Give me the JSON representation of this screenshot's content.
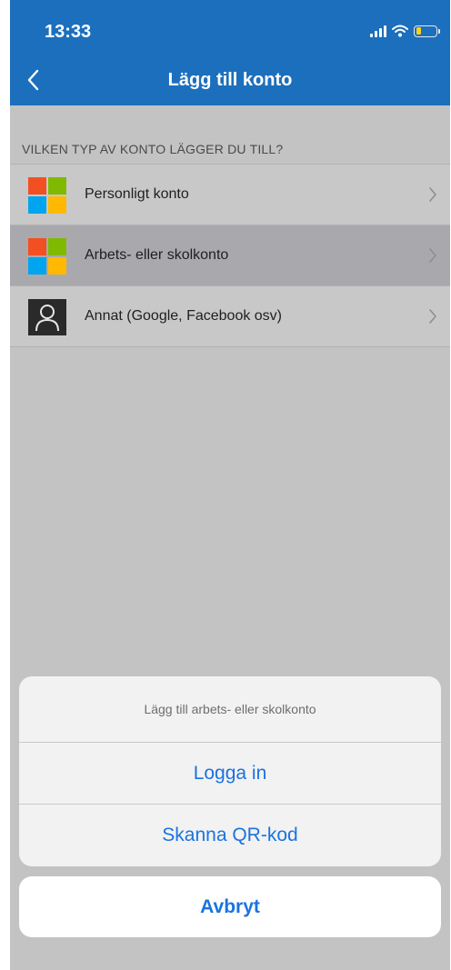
{
  "status_bar": {
    "time": "13:33",
    "icons": [
      "signal-icon",
      "wifi-icon",
      "battery-icon"
    ]
  },
  "nav": {
    "title": "Lägg till konto",
    "back_icon": "chevron-left-icon"
  },
  "section": {
    "header": "VILKEN TYP AV KONTO LÄGGER DU TILL?"
  },
  "accounts": [
    {
      "label": "Personligt konto",
      "icon": "microsoft-logo-icon",
      "selected": false
    },
    {
      "label": "Arbets- eller skolkonto",
      "icon": "microsoft-logo-icon",
      "selected": true
    },
    {
      "label": "Annat (Google, Facebook osv)",
      "icon": "person-icon",
      "selected": false
    }
  ],
  "action_sheet": {
    "title": "Lägg till arbets- eller skolkonto",
    "buttons": [
      "Logga in",
      "Skanna QR-kod"
    ],
    "cancel": "Avbryt"
  },
  "colors": {
    "brand_blue": "#1c6fbd",
    "action_blue": "#1a73e0",
    "ms_red": "#f25022",
    "ms_green": "#7fba00",
    "ms_blue": "#00a4ef",
    "ms_yellow": "#ffb900"
  }
}
